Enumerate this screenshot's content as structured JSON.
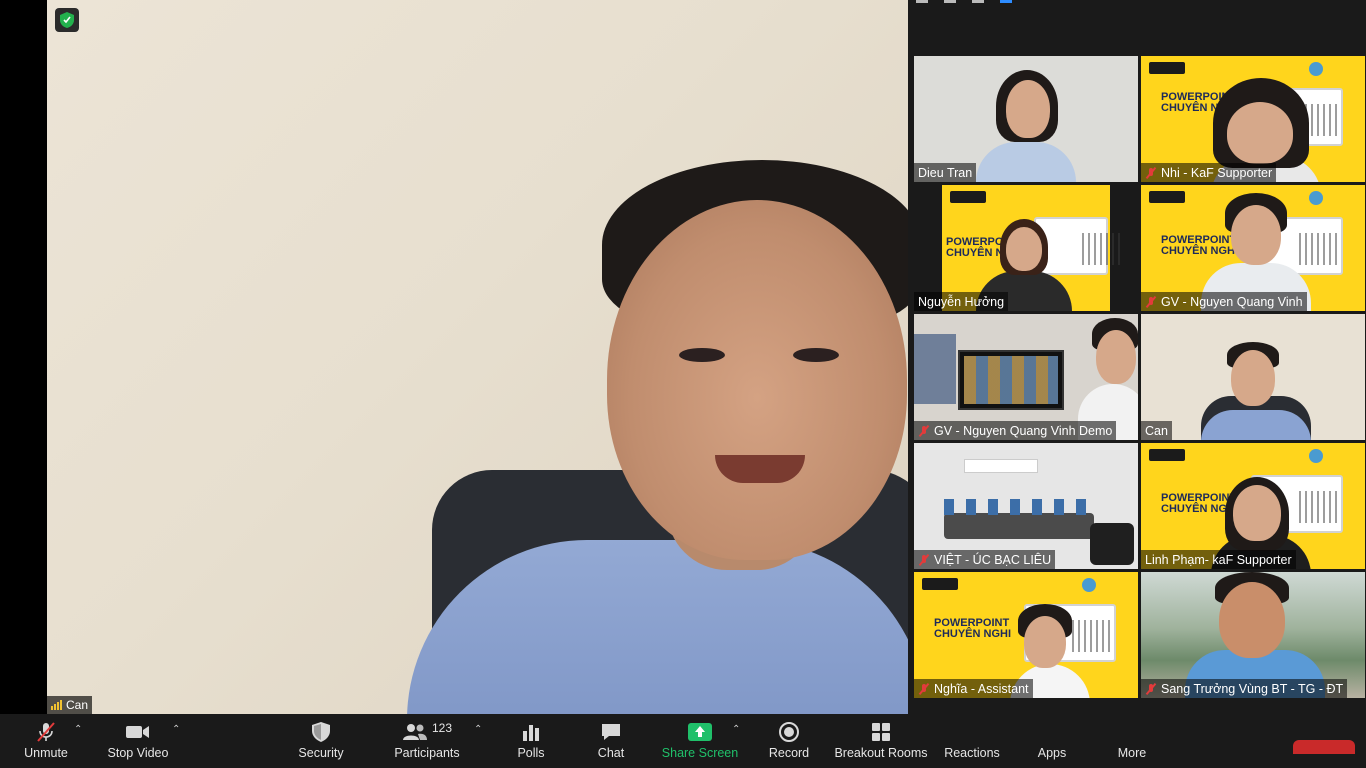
{
  "main_speaker": {
    "name": "Can"
  },
  "gallery": {
    "tiles": [
      {
        "name": "Dieu Tran",
        "muted": false
      },
      {
        "name": "Nhi - KaF Supporter",
        "muted": true
      },
      {
        "name": "Nguyễn Hưởng",
        "muted": false
      },
      {
        "name": "GV - Nguyen Quang Vinh",
        "muted": true
      },
      {
        "name": "GV - Nguyen Quang Vinh Demo",
        "muted": true
      },
      {
        "name": "Can",
        "muted": false
      },
      {
        "name": "VIỆT - ÚC BẠC LIÊU",
        "muted": true
      },
      {
        "name": "Linh Phạm- kaF Supporter",
        "muted": false
      },
      {
        "name": "Nghĩa - Assistant",
        "muted": true
      },
      {
        "name": "Sang Trưởng Vùng BT - TG - ĐT",
        "muted": true
      }
    ]
  },
  "slide_text": {
    "line1": "POWERPOINT",
    "line2": "CHUYÊN NGHI"
  },
  "toolbar": {
    "unmute": "Unmute",
    "stop_video": "Stop Video",
    "security": "Security",
    "participants": "Participants",
    "participants_count": "123",
    "polls": "Polls",
    "chat": "Chat",
    "share_screen": "Share Screen",
    "record": "Record",
    "breakout_rooms": "Breakout Rooms",
    "reactions": "Reactions",
    "apps": "Apps",
    "more": "More"
  },
  "colors": {
    "share_green": "#20c06a",
    "slide_yellow": "#ffd51c",
    "end_red": "#c92a2a"
  }
}
